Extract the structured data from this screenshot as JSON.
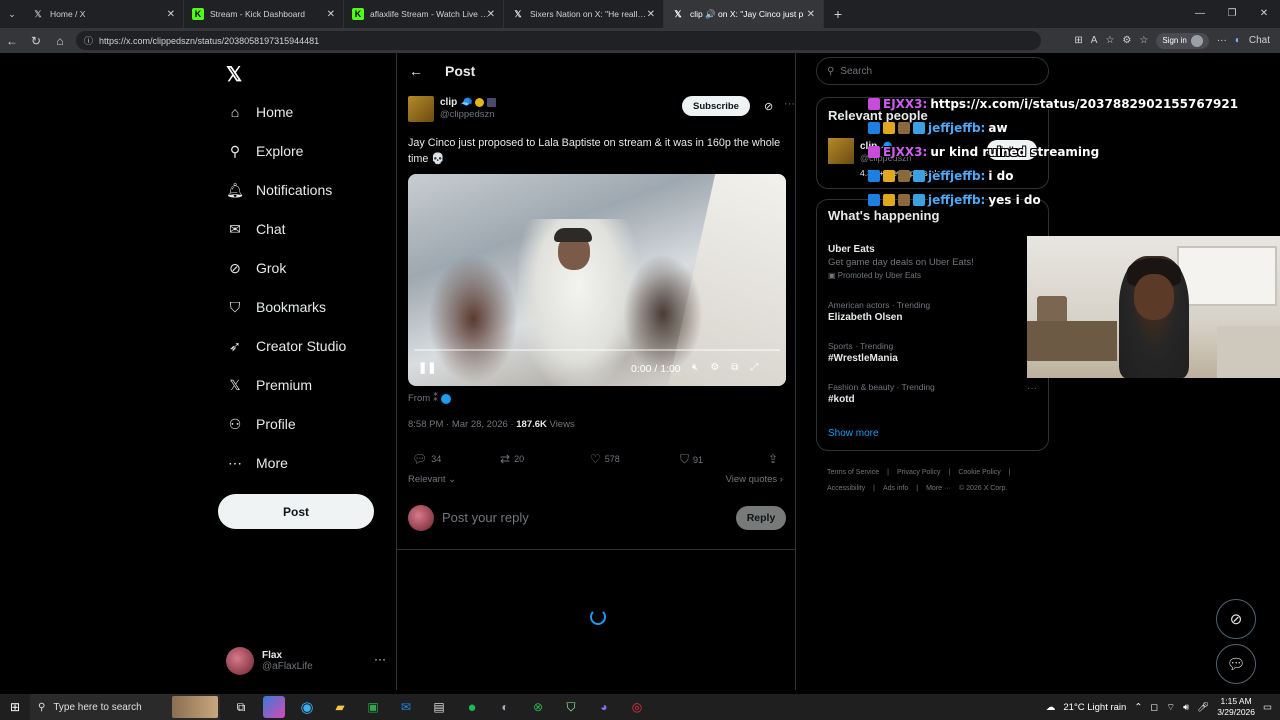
{
  "browser": {
    "tabs": [
      {
        "title": "Home / X",
        "icon": "x-logo-icon",
        "fav_color": "#000000",
        "fav_text": "𝕏",
        "active": false
      },
      {
        "title": "Stream - Kick Dashboard",
        "icon": "kick-logo-icon",
        "fav_color": "#53fc18",
        "fav_text": "K",
        "active": false
      },
      {
        "title": "aflaxlife Stream - Watch Live on Kick",
        "icon": "kick-logo-icon",
        "fav_color": "#53fc18",
        "fav_text": "K",
        "active": false
      },
      {
        "title": "Sixers Nation on X: \"He really could",
        "icon": "x-logo-icon",
        "fav_color": "#000000",
        "fav_text": "𝕏",
        "active": false
      },
      {
        "title": "clip 🔊 on X: \"Jay Cinco just p",
        "icon": "x-logo-icon",
        "fav_color": "#000000",
        "fav_text": "𝕏",
        "active": true
      }
    ],
    "url": "https://x.com/clippedszn/status/2038058197315944481",
    "signin_label": "Sign in",
    "chat_label": "Chat"
  },
  "sidebar": {
    "logo": "𝕏",
    "items": [
      {
        "label": "Home",
        "icon": "home-icon",
        "glyph": "⌂"
      },
      {
        "label": "Explore",
        "icon": "search-icon",
        "glyph": "⚲"
      },
      {
        "label": "Notifications",
        "icon": "bell-icon",
        "glyph": "🔔︎"
      },
      {
        "label": "Chat",
        "icon": "mail-icon",
        "glyph": "✉"
      },
      {
        "label": "Grok",
        "icon": "grok-icon",
        "glyph": "⊘"
      },
      {
        "label": "Bookmarks",
        "icon": "bookmark-icon",
        "glyph": "⛉"
      },
      {
        "label": "Creator Studio",
        "icon": "rocket-icon",
        "glyph": "➶"
      },
      {
        "label": "Premium",
        "icon": "x-logo-icon",
        "glyph": "𝕏"
      },
      {
        "label": "Profile",
        "icon": "person-icon",
        "glyph": "⚇"
      },
      {
        "label": "More",
        "icon": "more-circle-icon",
        "glyph": "⋯"
      }
    ],
    "post_label": "Post",
    "account": {
      "name": "Flax",
      "handle": "@aFlaxLife",
      "more": "···"
    }
  },
  "main": {
    "title": "Post",
    "author": {
      "name": "clip 🧢",
      "handle": "@clippedszn"
    },
    "subscribe_label": "Subscribe",
    "text": "Jay Cinco just proposed to Lala Baptiste on stream & it was in 160p the whole time 💀",
    "video": {
      "time": "0:00 / 1:00",
      "progress": 0.0
    },
    "from_label": "From",
    "from_glyph": "⁑",
    "meta_time": "8:58 PM · Mar 28, 2026 · ",
    "meta_views_count": "187.6K",
    "meta_views_label": " Views",
    "actions": {
      "replies": "34",
      "reposts": "20",
      "likes": "578",
      "bookmarks": "91"
    },
    "relevant_label": "Relevant",
    "view_quotes_label": "View quotes",
    "reply_placeholder": "Post your reply",
    "reply_label": "Reply"
  },
  "right": {
    "search_placeholder": "Search",
    "relevant_people_title": "Relevant people",
    "person": {
      "name": "clip 🧢",
      "handle": "@clippedszn",
      "bio": "4.3M+ views possible"
    },
    "follow_label": "Follow",
    "happening_title": "What's happening",
    "trends": [
      {
        "category": "",
        "title": "Uber Eats",
        "sub": "Get game day deals on Uber Eats!",
        "promo": "Promoted by Uber Eats"
      },
      {
        "category": "American actors · Trending",
        "title": "Elizabeth Olsen",
        "sub": "",
        "promo": ""
      },
      {
        "category": "Sports · Trending",
        "title": "#WrestleMania",
        "sub": "",
        "promo": ""
      },
      {
        "category": "Fashion & beauty · Trending",
        "title": "#kotd",
        "sub": "",
        "promo": ""
      }
    ],
    "show_more": "Show more",
    "footer": [
      "Terms of Service",
      "|",
      "Privacy Policy",
      "|",
      "Cookie Policy",
      "|",
      "Accessibility",
      "|",
      "Ads info",
      "|",
      "More ···",
      "© 2026 X Corp."
    ]
  },
  "chat": [
    {
      "user": "EJXX3:",
      "user_color": "pink",
      "message": "https://x.com/i/status/2037882902155767921",
      "badges": 0
    },
    {
      "user": "jeffjeffb:",
      "user_color": "blue",
      "message": "aw",
      "badges": 4
    },
    {
      "user": "EJXX3:",
      "user_color": "pink",
      "message": "ur kind ruined streaming",
      "badges": 0
    },
    {
      "user": "jeffjeffb:",
      "user_color": "blue",
      "message": "i do",
      "badges": 4
    },
    {
      "user": "jeffjeffb:",
      "user_color": "blue",
      "message": "yes i do",
      "badges": 4
    }
  ],
  "taskbar": {
    "search_placeholder": "Type here to search",
    "weather": "21°C  Light rain",
    "time": "1:15 AM",
    "date": "3/29/2026"
  },
  "colors": {
    "accent": "#1d9bf0",
    "background": "#000000",
    "border": "#2f3336",
    "muted": "#71767b"
  }
}
